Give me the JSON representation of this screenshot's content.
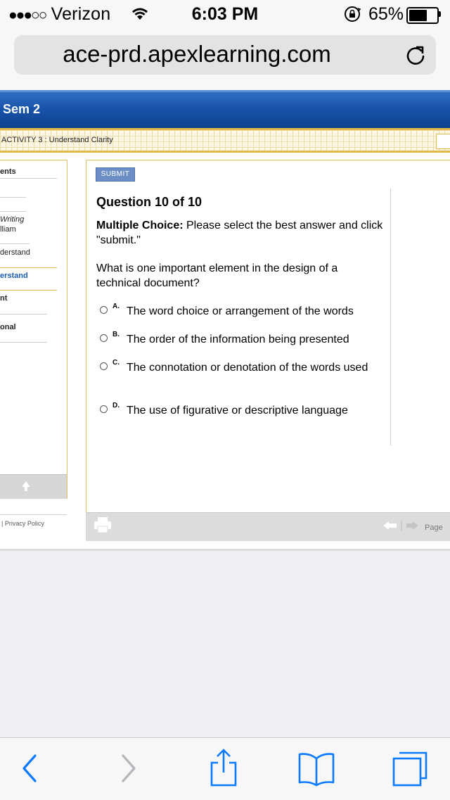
{
  "status": {
    "signal": "●●●○○",
    "carrier": "Verizon",
    "time": "6:03 PM",
    "battery_percent": "65%",
    "battery_level": 0.65,
    "icons": [
      "wifi-icon",
      "rotation-lock-icon",
      "battery-icon"
    ]
  },
  "browser": {
    "url": "ace-prd.apexlearning.com",
    "reload_icon": "reload-icon",
    "toolbar_icons": [
      "back-icon",
      "forward-icon",
      "share-icon",
      "bookmarks-icon",
      "tabs-icon"
    ]
  },
  "header": {
    "title": "Sem 2",
    "activity": "ACTIVITY 3 : Understand Clarity"
  },
  "sidebar": {
    "items": [
      {
        "label": "ents"
      },
      {
        "label": "Writing"
      },
      {
        "label": "lliam"
      },
      {
        "label": "derstand"
      },
      {
        "label": "erstand"
      },
      {
        "label": "nt"
      },
      {
        "label": "onal"
      }
    ],
    "privacy": "| Privacy Policy"
  },
  "question": {
    "submit_label": "SUBMIT",
    "title": "Question 10 of 10",
    "instruction_bold": "Multiple Choice:",
    "instruction_rest": " Please select the best answer and click \"submit.\"",
    "prompt": "What is one important element in the design of a technical document?",
    "options": [
      {
        "letter": "A.",
        "text": "The word choice or arrangement of the words"
      },
      {
        "letter": "B.",
        "text": "The order of the information being presented"
      },
      {
        "letter": "C.",
        "text": "The connotation or denotation of the words used"
      },
      {
        "letter": "D.",
        "text": "The use of figurative or descriptive language"
      }
    ]
  },
  "footer": {
    "page_label": "Page"
  },
  "colors": {
    "header_blue": "#1753a9",
    "gold": "#e2b84a",
    "link_blue": "#1a5fb4",
    "ios_blue": "#0a7aff",
    "submit_blue": "#6b8ec5"
  }
}
